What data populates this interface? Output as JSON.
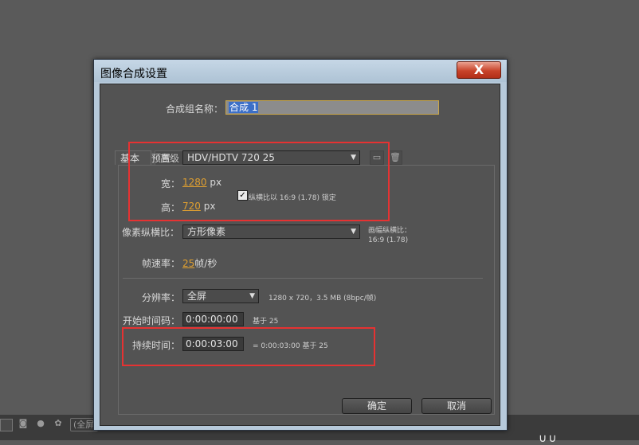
{
  "dialog": {
    "title": "图像合成设置",
    "close_glyph": "X",
    "comp_name_label": "合成组名称：",
    "comp_name_value": "合成 1",
    "tabs": [
      {
        "label": "基本"
      },
      {
        "label": "高级"
      }
    ],
    "preset": {
      "label": "预置：",
      "value": "HDV/HDTV 720 25",
      "save_icon": "▭",
      "delete_icon": "🗑"
    },
    "width": {
      "label": "宽：",
      "value": "1280",
      "unit": "px"
    },
    "height": {
      "label": "高：",
      "value": "720",
      "unit": "px"
    },
    "lock_aspect": {
      "checked": true,
      "check_glyph": "✓",
      "label": "纵横比以 16:9 (1.78) 锁定"
    },
    "pixel_aspect": {
      "label": "像素纵横比：",
      "value": "方形像素"
    },
    "frame_aspect": {
      "label": "画幅纵横比：",
      "value": "16:9 (1.78)"
    },
    "frame_rate": {
      "label": "帧速率：",
      "value": "25",
      "unit": "帧/秒"
    },
    "resolution": {
      "label": "分辨率：",
      "value": "全屏",
      "info": "1280 x 720，3.5 MB (8bpc/帧)"
    },
    "start_timecode": {
      "label": "开始时间码：",
      "value": "0:00:00:00",
      "note": "基于 25"
    },
    "duration": {
      "label": "持续时间：",
      "value": "0:00:03:00",
      "note": "= 0:00:03:00  基于 25"
    },
    "ok_label": "确定",
    "cancel_label": "取消",
    "dropdown_arrow": "▼"
  },
  "bottom_bar": {
    "camera_icon": "◙",
    "person_icon": "●",
    "color_icon": "✿",
    "menu_label": "(全屏",
    "dots": "∪∪"
  },
  "colors": {
    "highlight_red": "#e63232",
    "value_orange": "#e0a030",
    "title_bar": "#b6c9da",
    "close_button": "#c8432a"
  }
}
